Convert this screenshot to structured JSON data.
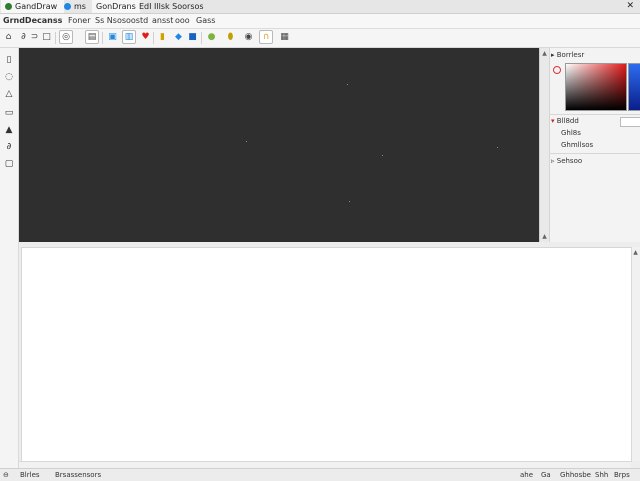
{
  "tabs": [
    {
      "label": "GandDraw",
      "dot_color": "#2e7d32"
    },
    {
      "label": "ms",
      "dot_color": "#1e88e5"
    },
    {
      "label": "GonDrans",
      "dot_color": ""
    },
    {
      "label": "EdI Illsk Soorsos",
      "dot_color": ""
    }
  ],
  "window": {
    "close_glyph": "✕"
  },
  "menu": {
    "items": [
      "GrndDecanss",
      "Foner",
      "Ss Nsosoostd",
      "ansst",
      "ooo",
      "Gass"
    ]
  },
  "toolbar": {
    "icons": [
      "lock-icon",
      "undo-icon",
      "redo-icon",
      "frame-icon",
      "spiral-icon",
      "layers-icon",
      "box-icon",
      "window-icon",
      "heart-icon",
      "bookmark-icon",
      "drop-icon",
      "color-icon",
      "globe-icon",
      "shield-icon",
      "target-icon",
      "horseshoe-icon",
      "layout-icon"
    ]
  },
  "left_tools": [
    "file-icon",
    "lasso-icon",
    "pen-icon",
    "ruler-icon",
    "bucket-icon",
    "brush-icon",
    "page-icon"
  ],
  "right_panel": {
    "title": "Borrlesr",
    "rows": [
      "Bll8dd",
      "Ghl8s",
      "Ghmllsos",
      "Sehsoo"
    ]
  },
  "status": {
    "left1": "Blrles",
    "left2": "Brsassensors",
    "right": [
      "ahe",
      "Ga",
      "Ghhosbe",
      "Shh",
      "Brps"
    ]
  },
  "colors": {
    "canvas": "#2f2f2f",
    "accent_red": "#e21b1b",
    "accent_blue": "#2d6df0"
  }
}
